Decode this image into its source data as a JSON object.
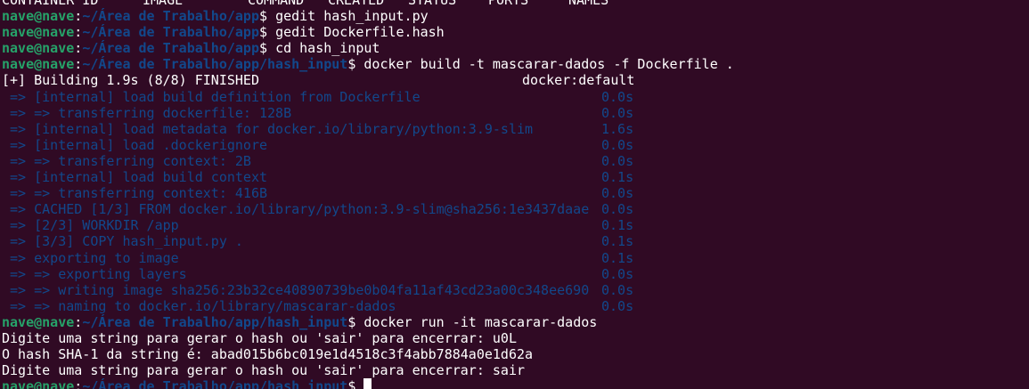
{
  "header_row": [
    "CONTAINER ID",
    "IMAGE",
    "COMMAND",
    "CREATED",
    "STATUS",
    "PORTS",
    "NAMES"
  ],
  "prompt": {
    "user_host": "nave@nave",
    "separator": ":",
    "dollar": "$ "
  },
  "commands": [
    {
      "path": "~/Área de Trabalho/app",
      "cmd": "gedit hash_input.py"
    },
    {
      "path": "~/Área de Trabalho/app",
      "cmd": "gedit Dockerfile.hash"
    },
    {
      "path": "~/Área de Trabalho/app",
      "cmd": "cd hash_input"
    },
    {
      "path": "~/Área de Trabalho/app/hash_input",
      "cmd": "docker build -t mascarar-dados -f Dockerfile ."
    }
  ],
  "build": {
    "status": "[+] Building 1.9s (8/8) FINISHED",
    "context": "docker:default",
    "steps": [
      {
        "text": " => [internal] load build definition from Dockerfile",
        "time": "0.0s"
      },
      {
        "text": " => => transferring dockerfile: 128B",
        "time": "0.0s"
      },
      {
        "text": " => [internal] load metadata for docker.io/library/python:3.9-slim",
        "time": "1.6s"
      },
      {
        "text": " => [internal] load .dockerignore",
        "time": "0.0s"
      },
      {
        "text": " => => transferring context: 2B",
        "time": "0.0s"
      },
      {
        "text": " => [internal] load build context",
        "time": "0.1s"
      },
      {
        "text": " => => transferring context: 416B",
        "time": "0.0s"
      },
      {
        "text": " => CACHED [1/3] FROM docker.io/library/python:3.9-slim@sha256:1e3437daae",
        "time": "0.0s"
      },
      {
        "text": " => [2/3] WORKDIR /app",
        "time": "0.1s"
      },
      {
        "text": " => [3/3] COPY hash_input.py .",
        "time": "0.1s"
      },
      {
        "text": " => exporting to image",
        "time": "0.1s"
      },
      {
        "text": " => => exporting layers",
        "time": "0.0s"
      },
      {
        "text": " => => writing image sha256:23b32ce40890739be0b04fa11af43cd23a00c348ee690",
        "time": "0.0s"
      },
      {
        "text": " => => naming to docker.io/library/mascarar-dados",
        "time": "0.0s"
      }
    ]
  },
  "run": {
    "path": "~/Área de Trabalho/app/hash_input",
    "cmd": "docker run -it mascarar-dados"
  },
  "output": [
    "Digite uma string para gerar o hash ou 'sair' para encerrar: u0L",
    "O hash SHA-1 da string é: abad015b6bc019e1d4518c3f4abb7884a0e1d62a",
    "Digite uma string para gerar o hash ou 'sair' para encerrar: sair"
  ],
  "final_prompt": {
    "path": "~/Área de Trabalho/app/hash_input"
  },
  "colors": {
    "background": "#300a24",
    "user": "#26a269",
    "path": "#12488b",
    "text": "#ffffff"
  }
}
